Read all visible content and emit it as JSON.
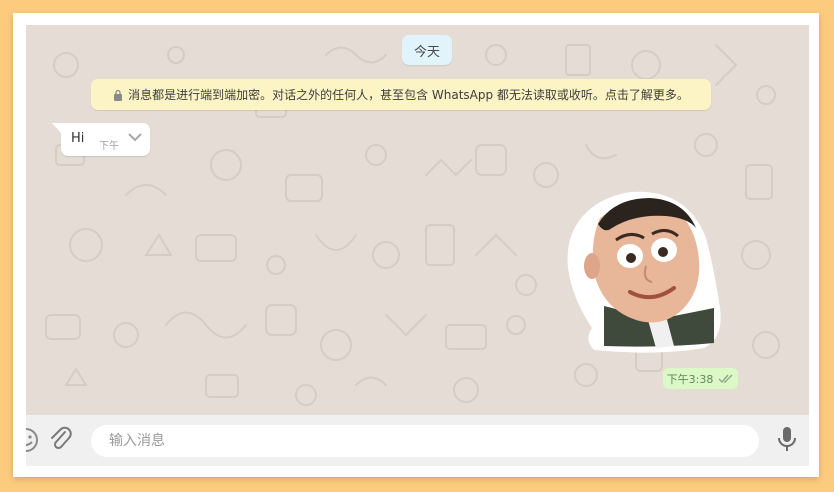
{
  "chat": {
    "date_separator": "今天",
    "encryption_notice": "消息都是进行端到端加密。对话之外的任何人，甚至包含 WhatsApp 都无法读取或收听。点击了解更多。",
    "messages": [
      {
        "direction": "incoming",
        "text": "Hi",
        "time": "下午",
        "menu_icon": "chevron-down-icon"
      },
      {
        "direction": "outgoing",
        "type": "sticker",
        "sticker_subject": "cartoon-man-face",
        "time": "下午3:38",
        "status": "read",
        "status_icon": "double-check-icon"
      }
    ]
  },
  "composer": {
    "placeholder": "输入消息",
    "icons": [
      "emoji-icon",
      "paperclip-icon",
      "microphone-icon"
    ]
  },
  "colors": {
    "outer_background": "#fdcb7e",
    "chat_background": "#e5ddd5",
    "date_pill": "#e1f3fb",
    "encryption_banner": "#fcf4c4",
    "outgoing_bubble": "#dcf8c6",
    "incoming_bubble": "#ffffff",
    "composer_bar": "#f0f0f0"
  }
}
